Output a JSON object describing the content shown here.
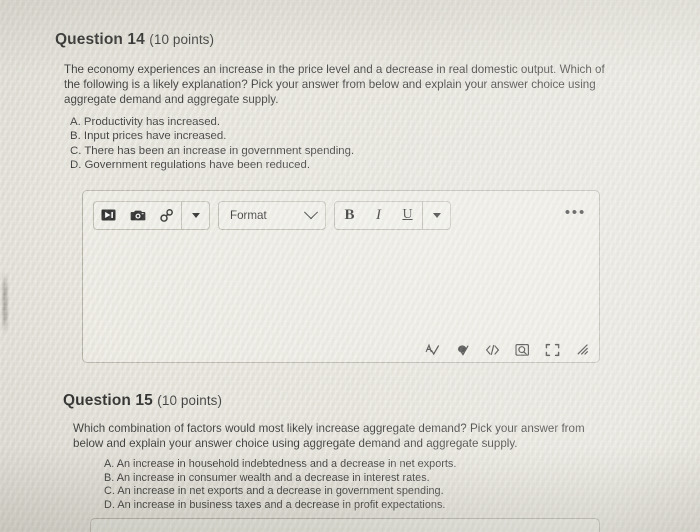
{
  "questions": [
    {
      "heading": "Question 14",
      "points": "(10 points)",
      "body": "The economy experiences an increase in the price level and a decrease in real domestic output. Which of the following is a likely explanation? Pick your answer from below and explain your answer choice using aggregate demand and aggregate supply.",
      "choices": [
        "A. Productivity has increased.",
        "B. Input prices have increased.",
        "C. There has been an increase in government spending.",
        "D. Government regulations have been reduced."
      ]
    },
    {
      "heading": "Question 15",
      "points": "(10 points)",
      "body": "Which combination of factors would most likely increase aggregate demand? Pick your answer from below and explain your answer choice using aggregate demand and aggregate supply.",
      "choices": [
        "A. An increase in household indebtedness and a decrease in net exports.",
        "B. An increase in consumer wealth and a decrease in interest rates.",
        "C. An increase in net exports and a decrease in government spending.",
        "D. An increase in business taxes and a decrease in profit expectations."
      ]
    }
  ],
  "editor": {
    "toolbar": {
      "insert_group": [
        {
          "name": "insert-media-icon",
          "title": "Insert media"
        },
        {
          "name": "insert-image-icon",
          "title": "Insert image"
        },
        {
          "name": "insert-link-icon",
          "title": "Insert link"
        }
      ],
      "insert_more_label": "More insert options",
      "format_label": "Format",
      "format_more_label": "More paragraph formatting",
      "style_group": [
        {
          "name": "bold-icon",
          "label": "B"
        },
        {
          "name": "italic-icon",
          "label": "I"
        },
        {
          "name": "underline-icon",
          "label": "U"
        }
      ],
      "style_more_label": "More text formatting",
      "overflow_label": "•••"
    },
    "content": "",
    "placeholder": "",
    "footer_tools": [
      {
        "name": "spellcheck-icon",
        "title": "Spell check"
      },
      {
        "name": "accessibility-icon",
        "title": "Accessibility checker"
      },
      {
        "name": "html-editor-icon",
        "title": "HTML editor"
      },
      {
        "name": "preview-icon",
        "title": "Preview"
      },
      {
        "name": "fullscreen-icon",
        "title": "Fullscreen"
      },
      {
        "name": "resize-handle-icon",
        "title": "Resize"
      }
    ]
  },
  "colors": {
    "page_background": "#e2e0d6",
    "text": "#262626",
    "editor_border": "#a9a79c"
  }
}
